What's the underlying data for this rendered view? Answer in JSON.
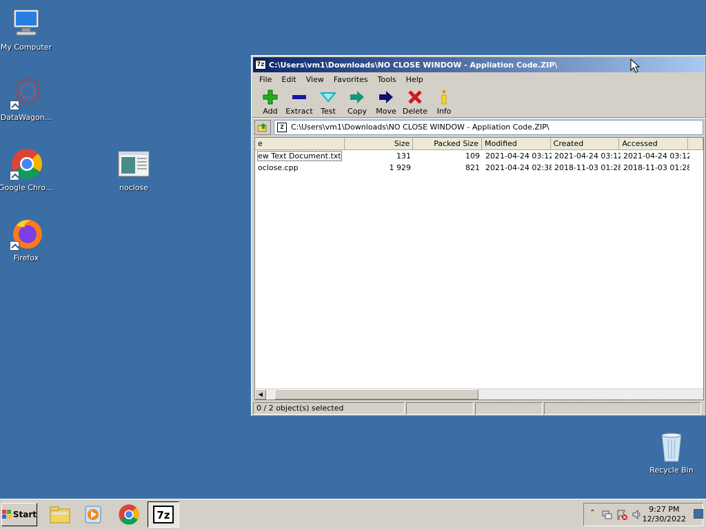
{
  "desktop": {
    "icons": [
      {
        "label": "My Computer"
      },
      {
        "label": "DataWagon..."
      },
      {
        "label": "Google Chrome"
      },
      {
        "label": "noclose"
      },
      {
        "label": "Firefox"
      },
      {
        "label": "Recycle Bin"
      }
    ]
  },
  "window": {
    "title_icon": "7z",
    "title": "C:\\Users\\vm1\\Downloads\\NO CLOSE WINDOW - Appliation Code.ZIP\\",
    "menu": [
      "File",
      "Edit",
      "View",
      "Favorites",
      "Tools",
      "Help"
    ],
    "toolbar": [
      {
        "label": "Add",
        "icon": "add-icon",
        "color": "#1fae1f"
      },
      {
        "label": "Extract",
        "icon": "extract-icon",
        "color": "#1515a8"
      },
      {
        "label": "Test",
        "icon": "test-icon",
        "color": "#12b0c0"
      },
      {
        "label": "Copy",
        "icon": "copy-icon",
        "color": "#16957e"
      },
      {
        "label": "Move",
        "icon": "move-icon",
        "color": "#10106e"
      },
      {
        "label": "Delete",
        "icon": "delete-icon",
        "color": "#d11a1a"
      },
      {
        "label": "Info",
        "icon": "info-icon",
        "color": "#c8a400"
      }
    ],
    "address": "C:\\Users\\vm1\\Downloads\\NO CLOSE WINDOW - Appliation Code.ZIP\\",
    "columns": [
      "e",
      "Size",
      "Packed Size",
      "Modified",
      "Created",
      "Accessed"
    ],
    "rows": [
      {
        "name": "ew Text Document.txt",
        "size": "131",
        "packed": "109",
        "modified": "2021-04-24 03:12",
        "created": "2021-04-24 03:12",
        "accessed": "2021-04-24 03:12"
      },
      {
        "name": "oclose.cpp",
        "size": "1 929",
        "packed": "821",
        "modified": "2021-04-24 02:38",
        "created": "2018-11-03 01:28",
        "accessed": "2018-11-03 01:28"
      }
    ],
    "status": "0 / 2 object(s) selected"
  },
  "taskbar": {
    "start_label": "Start",
    "clock_time": "9:27 PM",
    "clock_date": "12/30/2022"
  }
}
